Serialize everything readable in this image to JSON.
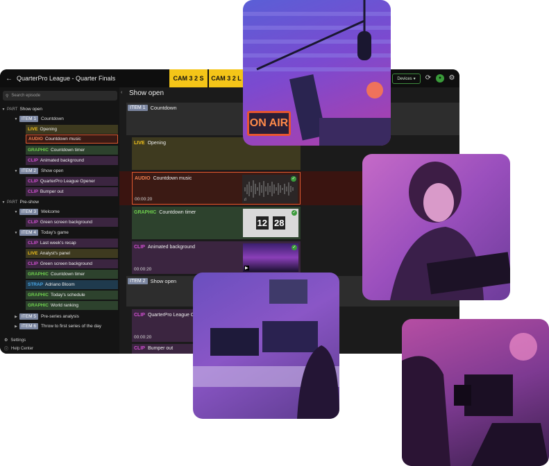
{
  "app": {
    "title": "QuarterPro League - Quarter Finals",
    "cameras": [
      "CAM 3 2 S",
      "CAM 3 2 L"
    ],
    "devices_label": "Devices"
  },
  "sidebar": {
    "search_placeholder": "Search episode",
    "part_label": "PART",
    "rows": [
      {
        "kind": "part",
        "name": "Show open"
      },
      {
        "kind": "item",
        "tag": "ITEM 1",
        "name": "Countdown"
      },
      {
        "kind": "cue",
        "type": "LIVE",
        "name": "Opening"
      },
      {
        "kind": "cue",
        "type": "AUDIO",
        "name": "Countdown music"
      },
      {
        "kind": "cue",
        "type": "GRAPHIC",
        "name": "Countdown timer"
      },
      {
        "kind": "cue",
        "type": "CLIP",
        "name": "Animated background"
      },
      {
        "kind": "item",
        "tag": "ITEM 2",
        "name": "Show open"
      },
      {
        "kind": "cue",
        "type": "CLIP",
        "name": "QuarterPro League Opener"
      },
      {
        "kind": "cue",
        "type": "CLIP",
        "name": "Bumper out"
      },
      {
        "kind": "part",
        "name": "Pre-show"
      },
      {
        "kind": "item",
        "tag": "ITEM 3",
        "name": "Welcome"
      },
      {
        "kind": "cue",
        "type": "CLIP",
        "name": "Green screen background"
      },
      {
        "kind": "item",
        "tag": "ITEM 4",
        "name": "Today's game"
      },
      {
        "kind": "cue",
        "type": "CLIP",
        "name": "Last week's recap"
      },
      {
        "kind": "cue",
        "type": "LIVE",
        "name": "Analyst's panel"
      },
      {
        "kind": "cue",
        "type": "CLIP",
        "name": "Green screen background"
      },
      {
        "kind": "cue",
        "type": "GRAPHIC",
        "name": "Countdown timer"
      },
      {
        "kind": "cue",
        "type": "STRAP",
        "name": "Adriano Bloom"
      },
      {
        "kind": "cue",
        "type": "GRAPHIC",
        "name": "Today's schedule"
      },
      {
        "kind": "cue",
        "type": "GRAPHIC",
        "name": "World ranking"
      },
      {
        "kind": "item",
        "tag": "ITEM 5",
        "name": "Pre-series analysis"
      },
      {
        "kind": "item",
        "tag": "ITEM 6",
        "name": "Throw to first series of the day"
      }
    ],
    "settings_label": "Settings",
    "help_label": "Help Center"
  },
  "main": {
    "show_title": "Show open",
    "item1": {
      "tag": "ITEM 1",
      "name": "Countdown"
    },
    "item2": {
      "tag": "ITEM 2",
      "name": "Show open"
    },
    "cards": [
      {
        "type": "LIVE",
        "name": "Opening",
        "duration": ""
      },
      {
        "type": "AUDIO",
        "name": "Countdown music",
        "duration": "00:00:20"
      },
      {
        "type": "GRAPHIC",
        "name": "Countdown timer",
        "duration": ""
      },
      {
        "type": "CLIP",
        "name": "Animated background",
        "duration": "00:00:20"
      },
      {
        "type": "CLIP",
        "name": "QuarterPro League O",
        "duration": "00:00:20"
      },
      {
        "type": "CLIP",
        "name": "Bumper out",
        "duration": ""
      }
    ],
    "countdown_digits": [
      "12",
      "28"
    ]
  },
  "photos": {
    "onair_sign": "ON AIR"
  }
}
